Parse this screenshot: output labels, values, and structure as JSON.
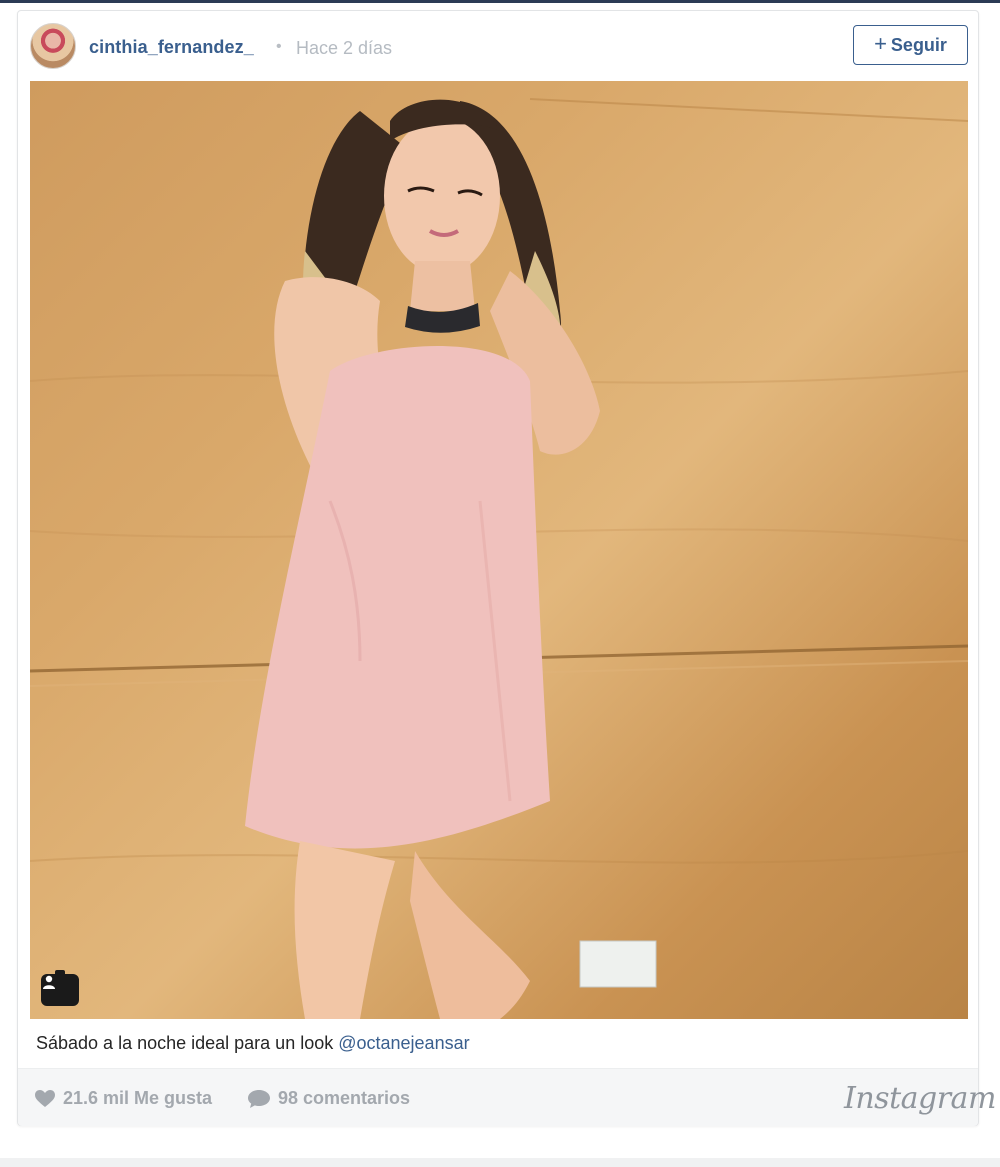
{
  "post": {
    "username": "cinthia_fernandez_",
    "separator": "•",
    "time_ago": "Hace 2 días",
    "follow_label": "Seguir",
    "caption_text": "Sábado a la noche ideal para un look ",
    "caption_mention": "@octanejeansar",
    "likes_label": "21.6 mil Me gusta",
    "comments_label": "98 comentarios",
    "brand_logo": "Instagram"
  },
  "icons": {
    "follow": "plus-icon",
    "likes": "heart-icon",
    "comments": "speech-bubble-icon",
    "photo_badge": "user-profile-icon"
  },
  "colors": {
    "accent": "#3a5f8e",
    "muted": "#a3a8ae",
    "footer_bg": "#f5f6f7"
  }
}
